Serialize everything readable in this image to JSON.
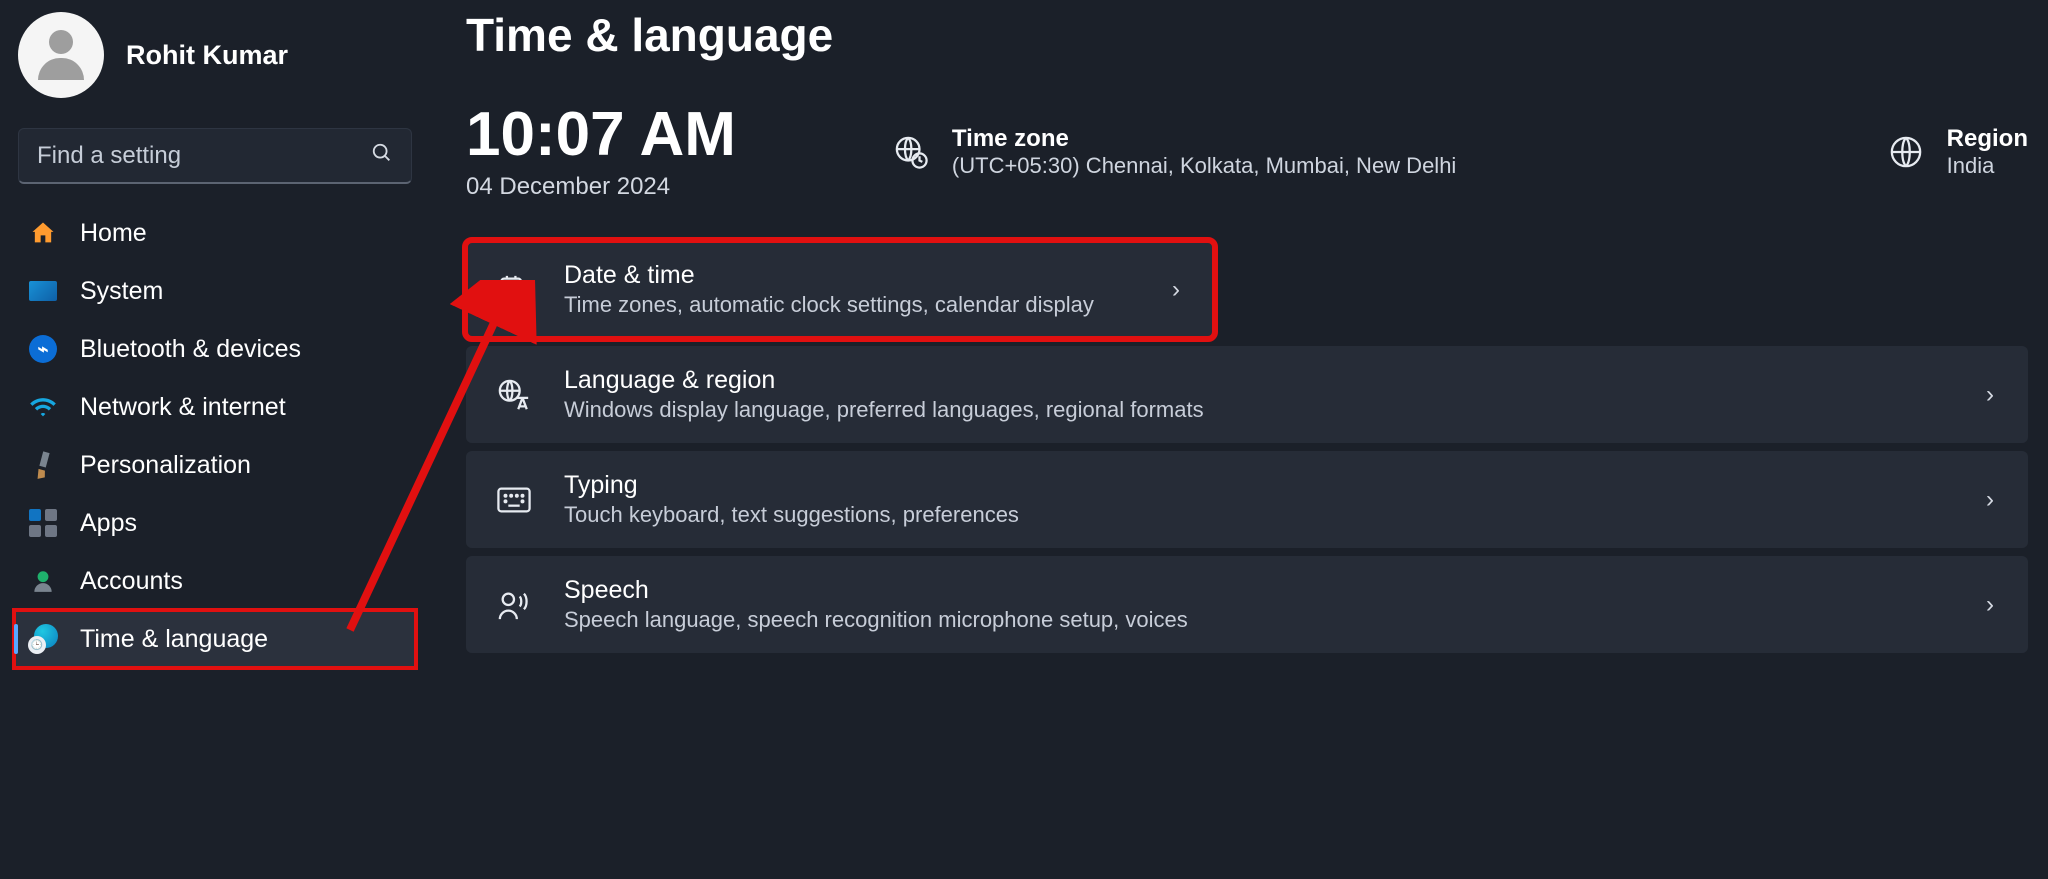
{
  "user": {
    "name": "Rohit Kumar"
  },
  "search": {
    "placeholder": "Find a setting"
  },
  "nav": {
    "home": "Home",
    "system": "System",
    "bluetooth": "Bluetooth & devices",
    "network": "Network & internet",
    "personalization": "Personalization",
    "apps": "Apps",
    "accounts": "Accounts",
    "timeLanguage": "Time & language"
  },
  "page": {
    "title": "Time & language",
    "time": "10:07 AM",
    "date": "04 December 2024",
    "tzLabel": "Time zone",
    "tzValue": "(UTC+05:30) Chennai, Kolkata, Mumbai, New Delhi",
    "regionLabel": "Region",
    "regionValue": "India"
  },
  "cards": {
    "dateTime": {
      "title": "Date & time",
      "sub": "Time zones, automatic clock settings, calendar display"
    },
    "langRegion": {
      "title": "Language & region",
      "sub": "Windows display language, preferred languages, regional formats"
    },
    "typing": {
      "title": "Typing",
      "sub": "Touch keyboard, text suggestions, preferences"
    },
    "speech": {
      "title": "Speech",
      "sub": "Speech language, speech recognition microphone setup, voices"
    }
  }
}
